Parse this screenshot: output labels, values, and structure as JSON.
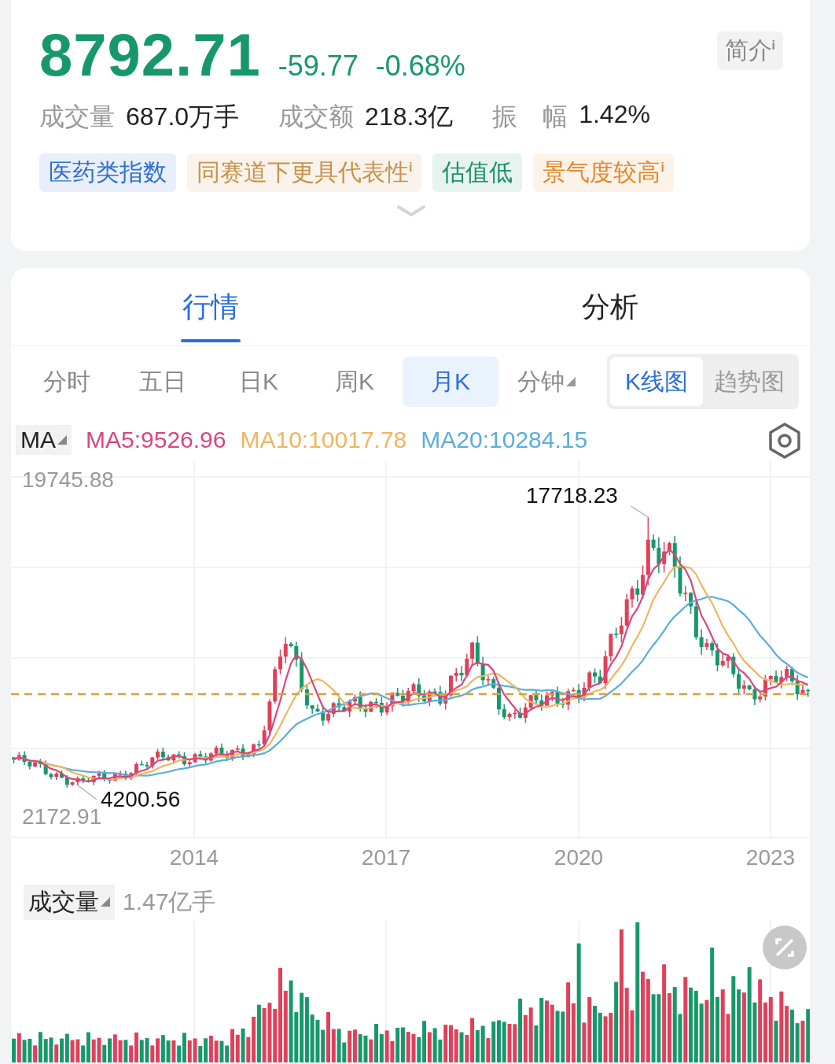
{
  "quote": {
    "price": "8792.71",
    "change": "-59.77",
    "change_pct": "-0.68%",
    "intro_button": {
      "label": "简介",
      "superscript": "i"
    },
    "stats": [
      {
        "label": "成交量",
        "value": "687.0万手"
      },
      {
        "label": "成交额",
        "value": "218.3亿"
      },
      {
        "label": "振　幅",
        "value": "1.42%"
      }
    ],
    "tags": [
      {
        "text": "医药类指数",
        "color": "#2f6fd0"
      },
      {
        "text": "同赛道下更具代表性",
        "color": "#c8924a",
        "superscript": "i"
      },
      {
        "text": "估值低",
        "color": "#1f8f68"
      },
      {
        "text": "景气度较高",
        "color": "#e08a2c",
        "superscript": "i"
      }
    ]
  },
  "tabs": [
    {
      "label": "行情",
      "selected": true
    },
    {
      "label": "分析",
      "selected": false
    }
  ],
  "periods": [
    {
      "label": "分时",
      "selected": false,
      "has_menu": false
    },
    {
      "label": "五日",
      "selected": false,
      "has_menu": false
    },
    {
      "label": "日K",
      "selected": false,
      "has_menu": false
    },
    {
      "label": "周K",
      "selected": false,
      "has_menu": false
    },
    {
      "label": "月K",
      "selected": true,
      "has_menu": false
    },
    {
      "label": "分钟",
      "selected": false,
      "has_menu": true
    }
  ],
  "chart_types": [
    {
      "label": "K线图",
      "selected": true
    },
    {
      "label": "趋势图",
      "selected": false
    }
  ],
  "ma_legend": {
    "selector": "MA",
    "items": [
      {
        "text": "MA5:9526.96",
        "color": "#d8467f"
      },
      {
        "text": "MA10:10017.78",
        "color": "#f0b560"
      },
      {
        "text": "MA20:10284.15",
        "color": "#5aaedb"
      }
    ]
  },
  "kline": {
    "top_label": "19745.88",
    "bottom_label": "2172.91",
    "high_label": "17718.23",
    "low_label": "4200.56",
    "x_labels": [
      "2014",
      "2017",
      "2020",
      "2023"
    ]
  },
  "volume": {
    "selector": "成交量",
    "max_label": "1.47亿手"
  }
}
